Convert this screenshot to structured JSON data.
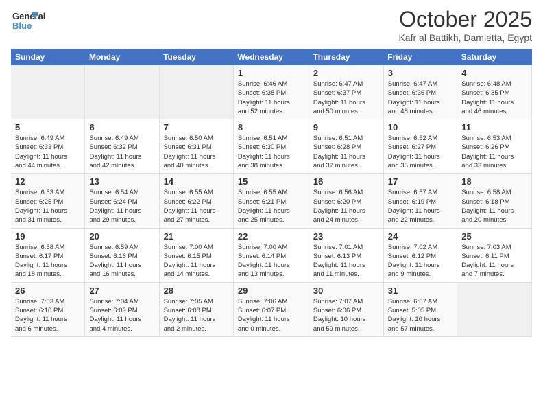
{
  "header": {
    "logo_line1": "General",
    "logo_line2": "Blue",
    "month": "October 2025",
    "location": "Kafr al Battikh, Damietta, Egypt"
  },
  "weekdays": [
    "Sunday",
    "Monday",
    "Tuesday",
    "Wednesday",
    "Thursday",
    "Friday",
    "Saturday"
  ],
  "weeks": [
    [
      {
        "day": "",
        "info": ""
      },
      {
        "day": "",
        "info": ""
      },
      {
        "day": "",
        "info": ""
      },
      {
        "day": "1",
        "info": "Sunrise: 6:46 AM\nSunset: 6:38 PM\nDaylight: 11 hours\nand 52 minutes."
      },
      {
        "day": "2",
        "info": "Sunrise: 6:47 AM\nSunset: 6:37 PM\nDaylight: 11 hours\nand 50 minutes."
      },
      {
        "day": "3",
        "info": "Sunrise: 6:47 AM\nSunset: 6:36 PM\nDaylight: 11 hours\nand 48 minutes."
      },
      {
        "day": "4",
        "info": "Sunrise: 6:48 AM\nSunset: 6:35 PM\nDaylight: 11 hours\nand 46 minutes."
      }
    ],
    [
      {
        "day": "5",
        "info": "Sunrise: 6:49 AM\nSunset: 6:33 PM\nDaylight: 11 hours\nand 44 minutes."
      },
      {
        "day": "6",
        "info": "Sunrise: 6:49 AM\nSunset: 6:32 PM\nDaylight: 11 hours\nand 42 minutes."
      },
      {
        "day": "7",
        "info": "Sunrise: 6:50 AM\nSunset: 6:31 PM\nDaylight: 11 hours\nand 40 minutes."
      },
      {
        "day": "8",
        "info": "Sunrise: 6:51 AM\nSunset: 6:30 PM\nDaylight: 11 hours\nand 38 minutes."
      },
      {
        "day": "9",
        "info": "Sunrise: 6:51 AM\nSunset: 6:28 PM\nDaylight: 11 hours\nand 37 minutes."
      },
      {
        "day": "10",
        "info": "Sunrise: 6:52 AM\nSunset: 6:27 PM\nDaylight: 11 hours\nand 35 minutes."
      },
      {
        "day": "11",
        "info": "Sunrise: 6:53 AM\nSunset: 6:26 PM\nDaylight: 11 hours\nand 33 minutes."
      }
    ],
    [
      {
        "day": "12",
        "info": "Sunrise: 6:53 AM\nSunset: 6:25 PM\nDaylight: 11 hours\nand 31 minutes."
      },
      {
        "day": "13",
        "info": "Sunrise: 6:54 AM\nSunset: 6:24 PM\nDaylight: 11 hours\nand 29 minutes."
      },
      {
        "day": "14",
        "info": "Sunrise: 6:55 AM\nSunset: 6:22 PM\nDaylight: 11 hours\nand 27 minutes."
      },
      {
        "day": "15",
        "info": "Sunrise: 6:55 AM\nSunset: 6:21 PM\nDaylight: 11 hours\nand 25 minutes."
      },
      {
        "day": "16",
        "info": "Sunrise: 6:56 AM\nSunset: 6:20 PM\nDaylight: 11 hours\nand 24 minutes."
      },
      {
        "day": "17",
        "info": "Sunrise: 6:57 AM\nSunset: 6:19 PM\nDaylight: 11 hours\nand 22 minutes."
      },
      {
        "day": "18",
        "info": "Sunrise: 6:58 AM\nSunset: 6:18 PM\nDaylight: 11 hours\nand 20 minutes."
      }
    ],
    [
      {
        "day": "19",
        "info": "Sunrise: 6:58 AM\nSunset: 6:17 PM\nDaylight: 11 hours\nand 18 minutes."
      },
      {
        "day": "20",
        "info": "Sunrise: 6:59 AM\nSunset: 6:16 PM\nDaylight: 11 hours\nand 16 minutes."
      },
      {
        "day": "21",
        "info": "Sunrise: 7:00 AM\nSunset: 6:15 PM\nDaylight: 11 hours\nand 14 minutes."
      },
      {
        "day": "22",
        "info": "Sunrise: 7:00 AM\nSunset: 6:14 PM\nDaylight: 11 hours\nand 13 minutes."
      },
      {
        "day": "23",
        "info": "Sunrise: 7:01 AM\nSunset: 6:13 PM\nDaylight: 11 hours\nand 11 minutes."
      },
      {
        "day": "24",
        "info": "Sunrise: 7:02 AM\nSunset: 6:12 PM\nDaylight: 11 hours\nand 9 minutes."
      },
      {
        "day": "25",
        "info": "Sunrise: 7:03 AM\nSunset: 6:11 PM\nDaylight: 11 hours\nand 7 minutes."
      }
    ],
    [
      {
        "day": "26",
        "info": "Sunrise: 7:03 AM\nSunset: 6:10 PM\nDaylight: 11 hours\nand 6 minutes."
      },
      {
        "day": "27",
        "info": "Sunrise: 7:04 AM\nSunset: 6:09 PM\nDaylight: 11 hours\nand 4 minutes."
      },
      {
        "day": "28",
        "info": "Sunrise: 7:05 AM\nSunset: 6:08 PM\nDaylight: 11 hours\nand 2 minutes."
      },
      {
        "day": "29",
        "info": "Sunrise: 7:06 AM\nSunset: 6:07 PM\nDaylight: 11 hours\nand 0 minutes."
      },
      {
        "day": "30",
        "info": "Sunrise: 7:07 AM\nSunset: 6:06 PM\nDaylight: 10 hours\nand 59 minutes."
      },
      {
        "day": "31",
        "info": "Sunrise: 6:07 AM\nSunset: 5:05 PM\nDaylight: 10 hours\nand 57 minutes."
      },
      {
        "day": "",
        "info": ""
      }
    ]
  ]
}
